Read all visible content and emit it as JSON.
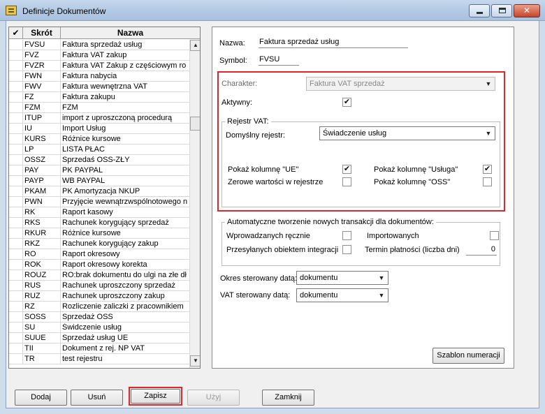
{
  "window": {
    "title": "Definicje Dokumentów"
  },
  "list": {
    "headers": {
      "check": "✔",
      "code": "Skrót",
      "name": "Nazwa"
    },
    "rows": [
      {
        "code": "FVSU",
        "name": "Faktura sprzedaż usług"
      },
      {
        "code": "FVZ",
        "name": "Faktura VAT zakup"
      },
      {
        "code": "FVZR",
        "name": "Faktura VAT Zakup z częściowym ro"
      },
      {
        "code": "FWN",
        "name": "Faktura nabycia"
      },
      {
        "code": "FWV",
        "name": "Faktura wewnętrzna VAT"
      },
      {
        "code": "FZ",
        "name": "Faktura zakupu"
      },
      {
        "code": "FZM",
        "name": "FZM"
      },
      {
        "code": "ITUP",
        "name": "import z uproszczoną procedurą"
      },
      {
        "code": "IU",
        "name": "Import Usług"
      },
      {
        "code": "KURS",
        "name": "Różnice kursowe"
      },
      {
        "code": "LP",
        "name": "LISTA PŁAC"
      },
      {
        "code": "OSSZ",
        "name": "Sprzedaś OSS-ZŁY"
      },
      {
        "code": "PAY",
        "name": "PK PAYPAL"
      },
      {
        "code": "PAYP",
        "name": "WB PAYPAL"
      },
      {
        "code": "PKAM",
        "name": "PK Amortyzacja NKUP"
      },
      {
        "code": "PWN",
        "name": "Przyjęcie wewnątrzwspólnotowego n"
      },
      {
        "code": "RK",
        "name": "Raport kasowy"
      },
      {
        "code": "RKS",
        "name": "Rachunek korygujący sprzedaż"
      },
      {
        "code": "RKUR",
        "name": "Różnice kursowe"
      },
      {
        "code": "RKZ",
        "name": "Rachunek korygujący zakup"
      },
      {
        "code": "RO",
        "name": "Raport okresowy"
      },
      {
        "code": "ROK",
        "name": "Raport okresowy korekta"
      },
      {
        "code": "ROUZ",
        "name": "RO:brak dokumentu do ulgi na złe dł"
      },
      {
        "code": "RUS",
        "name": "Rachunek uproszczony sprzedaż"
      },
      {
        "code": "RUZ",
        "name": "Rachunek uproszczony zakup"
      },
      {
        "code": "RZ",
        "name": "Rozliczenie zaliczki z pracownikiem"
      },
      {
        "code": "SOSS",
        "name": "Sprzedaż OSS"
      },
      {
        "code": "SU",
        "name": "Świdczenie usług"
      },
      {
        "code": "SUUE",
        "name": "Sprzedaż usług UE"
      },
      {
        "code": "TII",
        "name": "Dokument z rej. NP VAT"
      },
      {
        "code": "TR",
        "name": "test rejestru"
      }
    ]
  },
  "form": {
    "name_label": "Nazwa:",
    "name_value": "Faktura sprzedaż usług",
    "symbol_label": "Symbol:",
    "symbol_value": "FVSU",
    "character_label": "Charakter:",
    "character_value": "Faktura VAT sprzedaż",
    "active_label": "Aktywny:",
    "active_checked": true,
    "vat_group_title": "Rejestr VAT:",
    "default_register_label": "Domyślny rejestr:",
    "default_register_value": "Świadczenie usług",
    "show_ue_label": "Pokaż kolumnę \"UE\"",
    "show_ue_checked": true,
    "zero_values_label": "Zerowe wartości w rejestrze",
    "zero_values_checked": false,
    "show_service_label": "Pokaż kolumnę \"Usługa\"",
    "show_service_checked": true,
    "show_oss_label": "Pokaż kolumnę \"OSS\"",
    "show_oss_checked": false,
    "auto_group_title": "Automatyczne tworzenie nowych transakcji dla dokumentów:",
    "manual_label": "Wprowadzanych ręcznie",
    "imported_label": "Importowanych",
    "integration_label": "Przesyłanych obiektem integracji",
    "payment_term_label": "Termin płatności (liczba dni)",
    "payment_term_value": "0",
    "period_label": "Okres sterowany datą:",
    "period_value": "dokumentu",
    "vat_date_label": "VAT sterowany datą:",
    "vat_date_value": "dokumentu",
    "numbering_button": "Szablon numeracji"
  },
  "buttons": {
    "add": "Dodaj",
    "remove": "Usuń",
    "save": "Zapisz",
    "use": "Użyj",
    "close": "Zamknij"
  },
  "colors": {
    "highlight": "#e0262b"
  }
}
